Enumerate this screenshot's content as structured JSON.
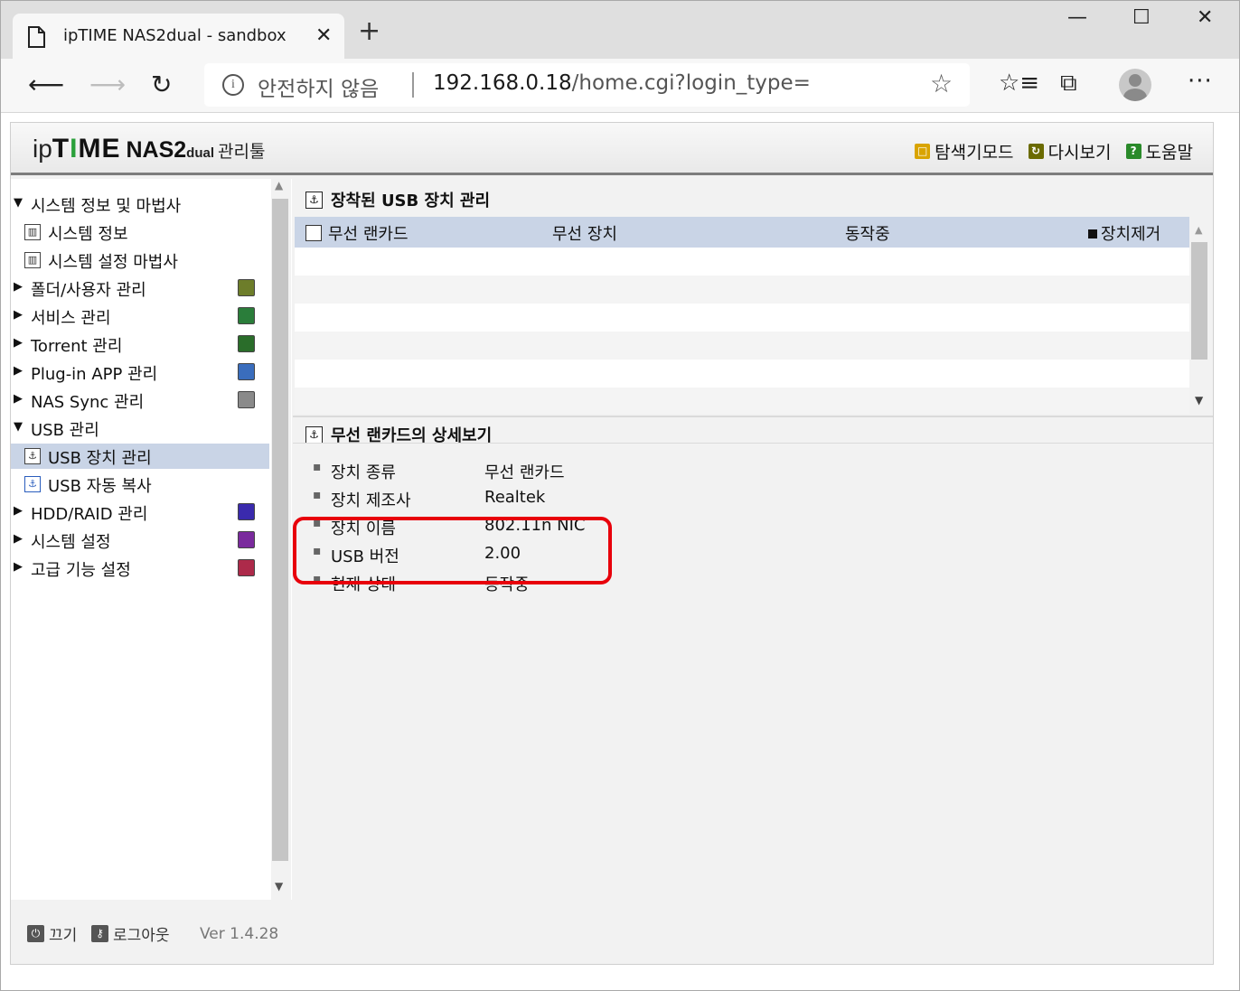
{
  "browser": {
    "tab_title": "ipTIME NAS2dual - sandbox",
    "tab_close": "✕",
    "new_tab": "+",
    "address_insecure": "안전하지 않음",
    "url_host": "192.168.0.18",
    "url_path": "/home.cgi?login_type=",
    "window_controls": {
      "minimize": "—",
      "maximize": "☐",
      "close": "✕"
    }
  },
  "app": {
    "brand": {
      "ip": "ip",
      "time_t": "T",
      "time_i": "I",
      "time_me": "ME",
      "model": "NAS2",
      "dual": "dual",
      "tool": "관리툴"
    },
    "header_links": [
      {
        "label": "탐색기모드",
        "color": "#d9a400"
      },
      {
        "label": "다시보기",
        "color": "#6b6b00"
      },
      {
        "label": "도움말",
        "color": "#2a8a2a"
      }
    ],
    "sidebar": {
      "items": [
        {
          "label": "시스템 정보 및 마법사",
          "type": "group",
          "expanded": true
        },
        {
          "label": "시스템 정보",
          "type": "sub",
          "icon": "chart-icon"
        },
        {
          "label": "시스템 설정 마법사",
          "type": "sub",
          "icon": "chart-icon"
        },
        {
          "label": "폴더/사용자 관리",
          "type": "group",
          "expanded": false,
          "icon_color": "#6d7d2a"
        },
        {
          "label": "서비스 관리",
          "type": "group",
          "expanded": false,
          "icon_color": "#2a7d3a"
        },
        {
          "label": "Torrent 관리",
          "type": "group",
          "expanded": false,
          "icon_color": "#2a6d2a"
        },
        {
          "label": "Plug-in APP 관리",
          "type": "group",
          "expanded": false,
          "icon_color": "#3a6dbd"
        },
        {
          "label": "NAS Sync 관리",
          "type": "group",
          "expanded": false,
          "icon_color": "#8a8a8a"
        },
        {
          "label": "USB 관리",
          "type": "group",
          "expanded": true
        },
        {
          "label": "USB 장치 관리",
          "type": "sub",
          "icon": "usb-icon",
          "selected": true
        },
        {
          "label": "USB 자동 복사",
          "type": "sub",
          "icon": "usb-icon"
        },
        {
          "label": "HDD/RAID 관리",
          "type": "group",
          "expanded": false,
          "icon_color": "#3a2aad"
        },
        {
          "label": "시스템 설정",
          "type": "group",
          "expanded": false,
          "icon_color": "#7a2a9d"
        },
        {
          "label": "고급 기능 설정",
          "type": "group",
          "expanded": false,
          "icon_color": "#ad2a4a"
        }
      ]
    },
    "footer": {
      "power": "끄기",
      "logout": "로그아웃",
      "version": "Ver 1.4.28"
    },
    "main": {
      "usb_section_title": "장착된 USB 장치 관리",
      "table_headers": {
        "name": "무선 랜카드",
        "type": "무선 장치",
        "status": "동작중",
        "remove": "장치제거"
      },
      "detail_section_title": "무선 랜카드의 상세보기",
      "details": [
        {
          "key": "장치 종류",
          "value": "무선 랜카드"
        },
        {
          "key": "장치 제조사",
          "value": "Realtek"
        },
        {
          "key": "장치 이름",
          "value": "802.11n NIC"
        },
        {
          "key": "USB 버전",
          "value": "2.00"
        },
        {
          "key": "현재 상태",
          "value": "동작중"
        }
      ]
    },
    "highlight_color": "#e8000b"
  }
}
